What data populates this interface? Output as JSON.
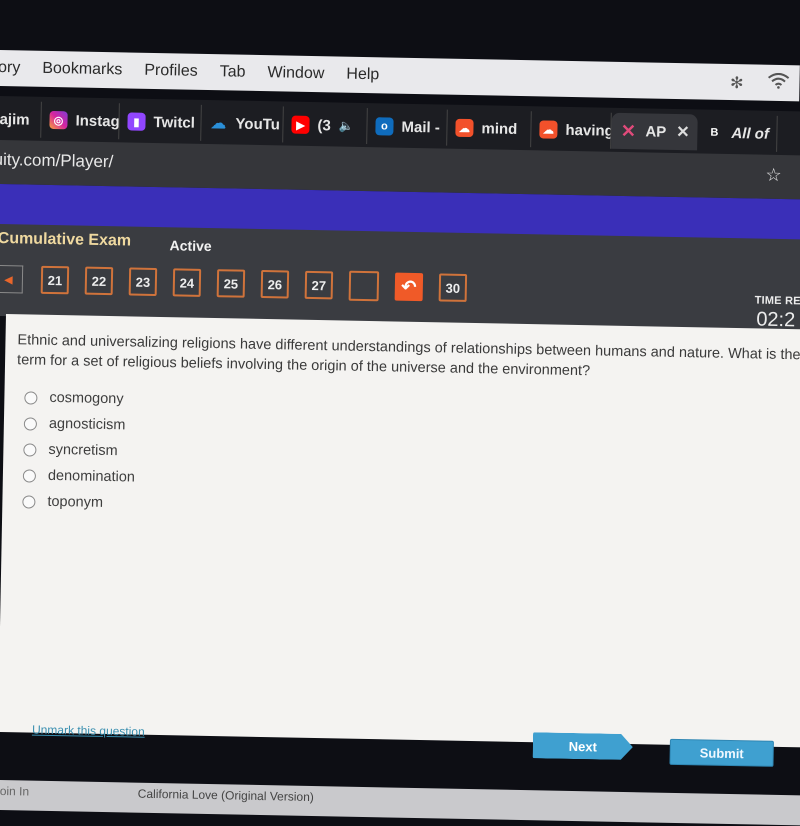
{
  "menubar": {
    "items": [
      "tory",
      "Bookmarks",
      "Profiles",
      "Tab",
      "Window",
      "Help"
    ],
    "status_icons": [
      "bluetooth-icon",
      "wifi-icon"
    ]
  },
  "tabs": [
    {
      "label": "ajim",
      "icon": "tab-favicon",
      "color": "#666666"
    },
    {
      "label": "Instag",
      "icon": "instagram-icon",
      "color": "#d6249f"
    },
    {
      "label": "Twitcl",
      "icon": "twitch-icon",
      "color": "#9146ff"
    },
    {
      "label": "YouTu",
      "icon": "cloud-download-icon",
      "color": "#2a8fd8"
    },
    {
      "label": "(3",
      "icon": "youtube-icon",
      "color": "#ff0000",
      "audio": "🔈"
    },
    {
      "label": "Mail -",
      "icon": "outlook-icon",
      "color": "#0f6cbd"
    },
    {
      "label": "mind",
      "icon": "soundcloud-icon",
      "color": "#f2512b"
    },
    {
      "label": "having",
      "icon": "soundcloud-icon",
      "color": "#f2512b"
    },
    {
      "label": "AP",
      "icon": "edgenuity-x-icon",
      "color": "#e04a7a",
      "active": true,
      "close": "✕"
    },
    {
      "label": "All of",
      "icon": "bold-b-icon",
      "color": "#222222"
    }
  ],
  "address": {
    "url": "uity.com/Player/",
    "bookmark_icon": "☆"
  },
  "exam": {
    "title": "Cumulative Exam",
    "status": "Active",
    "prev_icon": "◀",
    "questions": [
      {
        "label": "21",
        "state": "normal"
      },
      {
        "label": "22",
        "state": "normal"
      },
      {
        "label": "23",
        "state": "normal"
      },
      {
        "label": "24",
        "state": "normal"
      },
      {
        "label": "25",
        "state": "normal"
      },
      {
        "label": "26",
        "state": "normal"
      },
      {
        "label": "27",
        "state": "normal"
      },
      {
        "label": "",
        "state": "empty"
      },
      {
        "label": "↶",
        "state": "current"
      },
      {
        "label": "30",
        "state": "normal"
      }
    ],
    "timer_label": "TIME RE",
    "timer_value": "02:2"
  },
  "question": {
    "text": "Ethnic and universalizing religions have different understandings of relationships between humans and nature. What is the term for a set of religious beliefs involving the origin of the universe and the environment?",
    "choices": [
      "cosmogony",
      "agnosticism",
      "syncretism",
      "denomination",
      "toponym"
    ]
  },
  "footer": {
    "unmark": "Unmark this question",
    "next": "Next",
    "submit": "Submit"
  },
  "bottom": {
    "left": "oin In",
    "song": "California Love (Original Version)"
  }
}
